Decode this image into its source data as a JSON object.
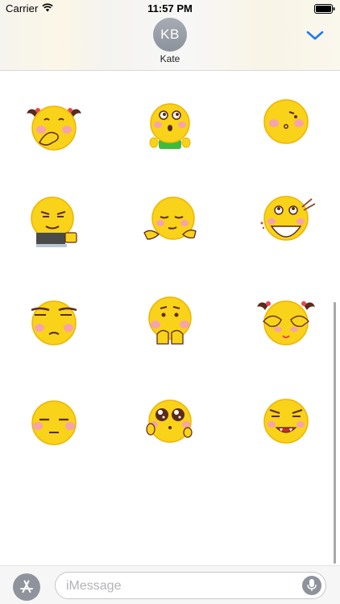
{
  "status_bar": {
    "carrier": "Carrier",
    "time": "11:57 PM",
    "icons": [
      "wifi-icon",
      "battery-icon"
    ]
  },
  "header": {
    "avatar_initials": "KB",
    "contact_name": "Kate",
    "collapse_icon": "chevron-down-icon",
    "accent_color": "#1a7cf5"
  },
  "stickers": [
    "emoji-covering-mouth-pigtails",
    "emoji-surprised-green-shirt",
    "emoji-whistling",
    "emoji-smirk-laptop",
    "emoji-shrug",
    "emoji-eating-noodles",
    "emoji-skeptical",
    "emoji-pleading",
    "emoji-covering-eyes-pigtails",
    "emoji-unamused",
    "emoji-starry-eyed",
    "emoji-evil-grin"
  ],
  "input_bar": {
    "placeholder": "iMessage",
    "left_button_icon": "app-store-icon",
    "mic_icon": "microphone-icon"
  }
}
